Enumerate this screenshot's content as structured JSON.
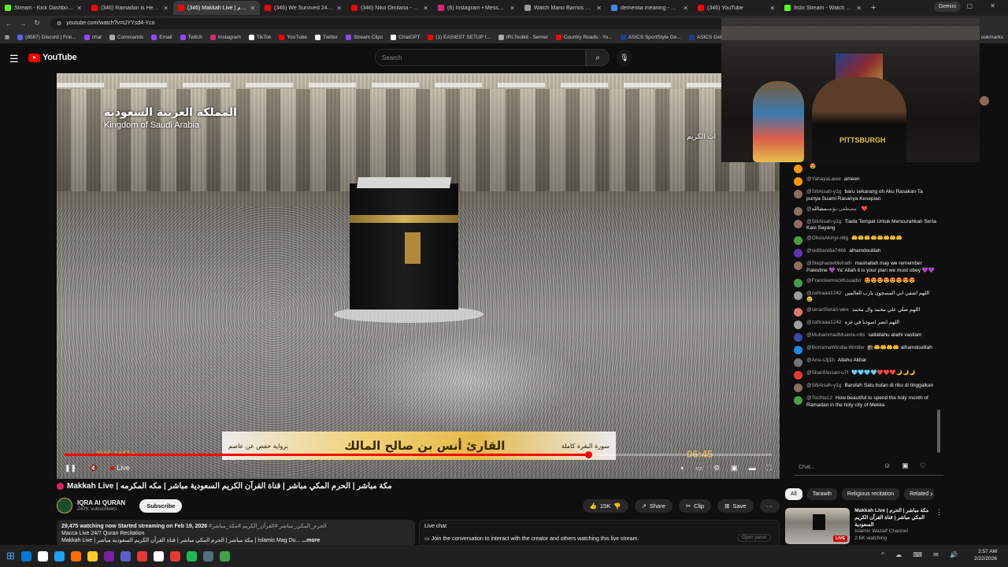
{
  "browser": {
    "tabs": [
      {
        "label": "Stream - Kick Dashboard",
        "color": "#53fc18"
      },
      {
        "label": "(346) Ramadan is Here! 🌙 A",
        "color": "#ff0000"
      },
      {
        "label": "(346) Makkah Live | الحرم",
        "color": "#ff0000",
        "active": true
      },
      {
        "label": "(346) We Survived 24 Hours",
        "color": "#ff0000"
      },
      {
        "label": "(346) Niko Omilana - YouTu",
        "color": "#ff0000"
      },
      {
        "label": "(6) Instagram • Messages",
        "color": "#d62976"
      },
      {
        "label": "Watch Mario Barrios vs Ryan",
        "color": "#999999"
      },
      {
        "label": "dementia meaning - Google",
        "color": "#4285f4"
      },
      {
        "label": "(346) YouTube",
        "color": "#ff0000"
      },
      {
        "label": "Itslix Stream - Watch Live o",
        "color": "#53fc18"
      }
    ],
    "new_tab": "+",
    "gemini_label": "Gemini",
    "window_controls": "— ▢ ✕",
    "url": "youtube.com/watch?v=tJYYsd4-Yco",
    "bookmarks": [
      {
        "label": "(8587) Discord | Frie...",
        "color": "#5865f2"
      },
      {
        "label": "chat",
        "color": "#9146ff"
      },
      {
        "label": "Commands",
        "color": "#aaaaaa"
      },
      {
        "label": "Email",
        "color": "#9146ff"
      },
      {
        "label": "Twitch",
        "color": "#9146ff"
      },
      {
        "label": "Instagram",
        "color": "#d62976"
      },
      {
        "label": "TikTok",
        "color": "#ffffff"
      },
      {
        "label": "YouTube",
        "color": "#ff0000"
      },
      {
        "label": "Twitter",
        "color": "#ffffff"
      },
      {
        "label": "Stream Clips",
        "color": "#9146ff"
      },
      {
        "label": "ChatGPT",
        "color": "#ffffff"
      },
      {
        "label": "(1) EASIEST SETUP f...",
        "color": "#ff0000"
      },
      {
        "label": "IRLToolkit - Server",
        "color": "#aaaaaa"
      },
      {
        "label": "Country Roads - Yo...",
        "color": "#ff0000"
      },
      {
        "label": "ASICS SportStyle Ge...",
        "color": "#1c3f94"
      },
      {
        "label": "ASICS Gel-Kayano 1",
        "color": "#1c3f94"
      }
    ],
    "bookmarks_end": "ookmarks"
  },
  "youtube": {
    "logo_text": "YouTube",
    "search_placeholder": "Search",
    "video": {
      "overlay_ar": "المملكة العربية السعودية",
      "overlay_en": "Kingdom of Saudi Arabia",
      "channel_bug": "ات الكريم",
      "banner_left": "برواية حفص عن عاصم",
      "banner_reader": "القارئ أنس بن صالح المالك",
      "banner_right": "سورة البقرة كاملة",
      "temp": "21°C",
      "hijri": "1447هـ",
      "clock": "06:45",
      "progress_percent": 74,
      "live_label": "Live"
    },
    "title": "Makkah Live | مكة مباشر | الحرم المكي مباشر | قناة القرآن الكريم السعودية مباشر | مكه المكرمه",
    "channel": {
      "name": "IQRA AI QURAN",
      "subs": "247K subscribers",
      "subscribe_label": "Subscribe"
    },
    "actions": {
      "likes": "15K",
      "share": "Share",
      "clip": "Clip",
      "save": "Save",
      "more": "···"
    },
    "description": {
      "stats": "29,475 watching now  Started streaming on Feb 19, 2026",
      "tags": "#الحرم_المكي_مباشر #القرآن_الكريم #مكة_مباشر",
      "line2": "Macca Live 24/7 Quran Recitation",
      "line3": "Makkah Live | مكة مباشر | الحرم المكي مباشر | قناة القرآن الكريم السعودية مباشر | Islamic Mag Du...",
      "more": "...more"
    },
    "live_chat_box": {
      "title": "Live chat",
      "text": "Join the conversation to interact with the creator and others watching this live stream.",
      "open_panel": "Open panel"
    },
    "chat": {
      "messages": [
        {
          "name": "",
          "text": "😍",
          "color": "#ff9800"
        },
        {
          "name": "@YahayaLawe",
          "text": "ameen",
          "color": "#ff9800"
        },
        {
          "name": "@SitiAisah-y1g",
          "text": "baru sekarang oh Aku Rasakan Ta punya Suami Rasanya Kesepian",
          "color": "#8d6e63"
        },
        {
          "name": "@مصطفى-يؤنس",
          "text": "مشالله ❤️",
          "color": "#8d6e63"
        },
        {
          "name": "@SitiAisah-y1g",
          "text": "Tiada Tempat Untuk Mencurahkan Serta Kasi Sayang",
          "color": "#8d6e63"
        },
        {
          "name": "@OliviaAkinyi-n6g",
          "text": "🤲🤲🤲🤲🤲🤲🤲🤲",
          "color": "#43a047"
        },
        {
          "name": "@sidibandia7466",
          "text": "alhamdoulilah",
          "color": "#5e35b1"
        },
        {
          "name": "@StephanieMelrath",
          "text": "mashallah may we remember Palestine 💜 Ya' Allah it is your plan we must obey 💜💜",
          "color": "#8d6e63"
        },
        {
          "name": "@FranckemockKouadio",
          "text": "😍😍😍😍😍😍😍😍",
          "color": "#43a047"
        },
        {
          "name": "@zahraaa1242",
          "text": "اللهم اشفي ابي المسجون يارب العالمين 😢",
          "color": "#9e9e9e"
        },
        {
          "name": "@seranSeran-wex",
          "text": "اللهم صلي علي محمد وال محمد",
          "color": "#e57373"
        },
        {
          "name": "@zahraaa1242",
          "text": "اللهم انصر اسودنا في غزه",
          "color": "#9e9e9e"
        },
        {
          "name": "@MuhammadMuavia-n8s",
          "text": "sallallahu alaihi vasllam",
          "color": "#3949ab"
        },
        {
          "name": "@BorramaWindia-Wm8w",
          "text": "🕋🤲🤲🤲🤲 alhamdoulilah",
          "color": "#1e88e5"
        },
        {
          "name": "@Anu-s3j1b",
          "text": "Allahu Akbar",
          "color": "#757575"
        },
        {
          "name": "@SharifAnsari-u7f",
          "text": "🩵🩵🩵🩵❤️❤️❤️🌙🌙🌙",
          "color": "#e53935"
        },
        {
          "name": "@SitiAisah-y1g",
          "text": "Barulah Satu bulan di riku di tinggalkan",
          "color": "#8d6e63"
        },
        {
          "name": "@Tochta12",
          "text": "How beautiful to spend the holy month of Ramadan in the holy city of Mekka",
          "color": "#43a047"
        }
      ],
      "input_placeholder": "Chat...",
      "icons": [
        "emoji-icon",
        "gift-icon",
        "heart-icon"
      ]
    },
    "chips": [
      "All",
      "Tarawih",
      "Religious recitation",
      "Related"
    ],
    "recommended": {
      "title": "Makkah Live | مكة مباشر | الحرم المكي مباشر | قناة القرآن الكريم السعودية",
      "channel": "Islamic Wazaif Channel",
      "watching": "2.6K watching",
      "badge": "LIVE"
    }
  },
  "webcam": {
    "shirt_text": "PITTSBURGH"
  },
  "taskbar": {
    "icons": [
      "#0078d4",
      "#ffffff",
      "#1da1f2",
      "#ff6d00",
      "#ffca28",
      "#7b1fa2",
      "#5b5fc7",
      "#e53935",
      "#ffffff",
      "#e53935",
      "#1db954",
      "#546e7a",
      "#43a047"
    ],
    "tray": "^ ☁ ⌨ ✉ 🔊",
    "time": "2:57 AM",
    "date": "2/22/2026"
  }
}
